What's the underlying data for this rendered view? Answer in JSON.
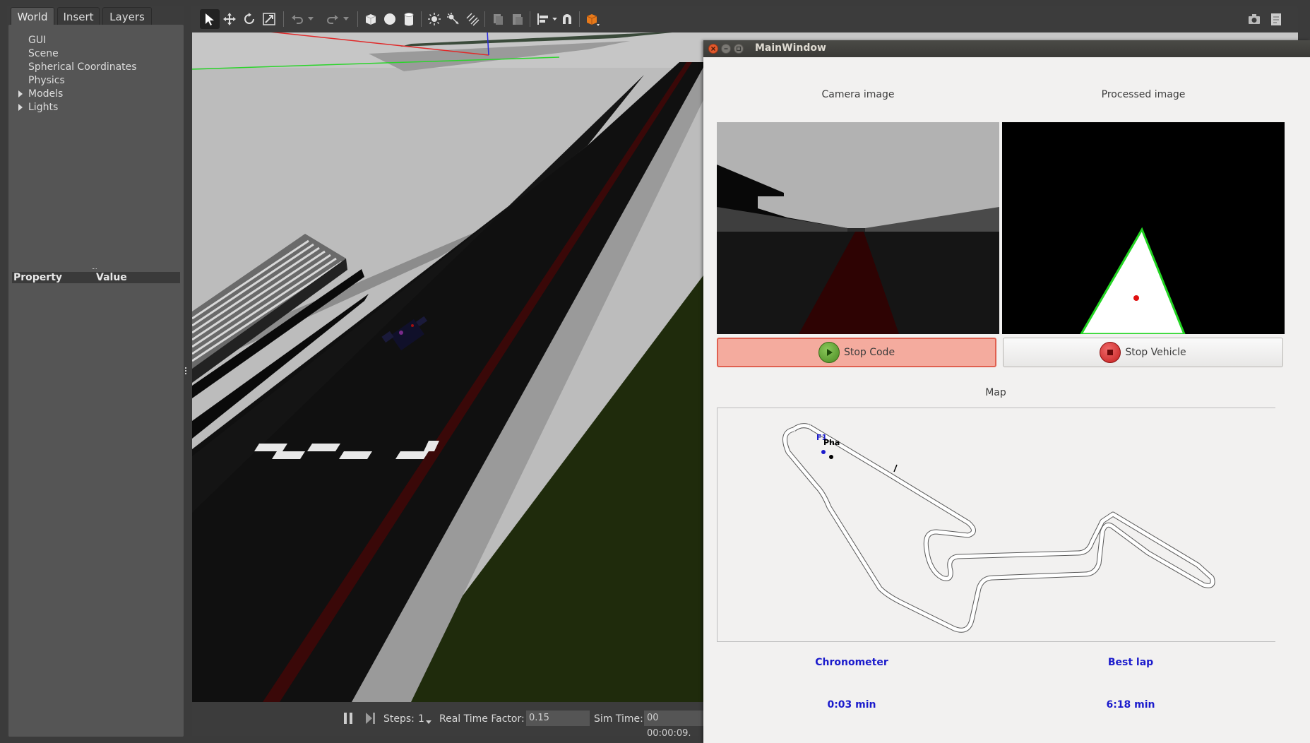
{
  "gazebo": {
    "left_tabs": [
      {
        "label": "World",
        "active": true
      },
      {
        "label": "Insert",
        "active": false
      },
      {
        "label": "Layers",
        "active": false
      }
    ],
    "world_tree": [
      "GUI",
      "Scene",
      "Spherical Coordinates",
      "Physics",
      "Models",
      "Lights"
    ],
    "property_header": {
      "property": "Property",
      "value": "Value"
    },
    "bottom_bar": {
      "steps_label": "Steps:",
      "steps_value": "1",
      "rtf_label": "Real Time Factor:",
      "rtf_value": "0.15",
      "sim_time_label": "Sim Time:",
      "sim_time_value": "00 00:00:09."
    }
  },
  "main_window": {
    "title": "MainWindow",
    "camera_caption": "Camera image",
    "processed_caption": "Processed image",
    "stop_code_label": "Stop Code",
    "stop_vehicle_label": "Stop Vehicle",
    "map_caption": "Map",
    "map_markers": {
      "f1_label": "F1",
      "pha_label": "Pha"
    },
    "chronometer_label": "Chronometer",
    "chronometer_value": "0:03 min",
    "best_lap_label": "Best lap",
    "best_lap_value": "6:18 min",
    "colors": {
      "stop_code_bg": "#f4ab9e",
      "stop_code_border": "#e06050",
      "go_green": "#5a9a2a",
      "stop_red": "#d42a2a",
      "stat_blue": "#1b1bcc"
    }
  }
}
